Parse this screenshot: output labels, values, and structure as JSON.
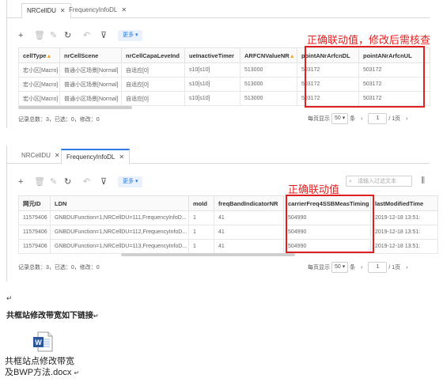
{
  "panel1": {
    "tabs": [
      {
        "label": "NRCellDU",
        "close": "✕"
      },
      {
        "label": "FrequencyInfoDL",
        "close": "✕"
      }
    ],
    "toolbar": {
      "more_label": "更多",
      "search_placeholder": ""
    },
    "columns": [
      "cellType",
      "nrCellScene",
      "nrCellCapaLeveInd",
      "ueInactiveTimer",
      "ARFCNValueNR",
      "pointANrArfcnDL",
      "pointANrArfcnUL"
    ],
    "warn_columns": [
      "cellType",
      "ARFCNValueNR"
    ],
    "rows": [
      [
        "宏小区[Macro]",
        "普通小区场景[Normal]",
        "自适应[0]",
        "s10[s10]",
        "513000",
        "503172",
        "503172"
      ],
      [
        "宏小区[Macro]",
        "普通小区场景[Normal]",
        "自适应[0]",
        "s10[s10]",
        "513000",
        "503172",
        "503172"
      ],
      [
        "宏小区[Macro]",
        "普通小区场景[Normal]",
        "自适应[0]",
        "s10[s10]",
        "513000",
        "503172",
        "503172"
      ]
    ],
    "record_info": "记录总数：3，已选：0，修改：0",
    "page_size_label": "每页显示",
    "page_size": "50",
    "page_unit": "条",
    "page_current": "1",
    "page_total": "/ 1页",
    "annotation": "正确联动值，修改后需核查"
  },
  "panel2": {
    "tabs": [
      {
        "label": "NRCellDU",
        "close": "✕"
      },
      {
        "label": "FrequencyInfoDL",
        "close": "✕"
      }
    ],
    "toolbar": {
      "more_label": "更多",
      "search_placeholder": "请输入过滤文本"
    },
    "columns": [
      "网元ID",
      "LDN",
      "moId",
      "freqBandIndicatorNR",
      "carrierFreq4SSBMeasTiming",
      "lastModifiedTime"
    ],
    "rows": [
      [
        "11579406",
        "GNBDUFunction=1,NRCellDU=111,FrequencyInfoD...",
        "1",
        "41",
        "504990",
        "2019-12-18 13:51:"
      ],
      [
        "11579406",
        "GNBDUFunction=1,NRCellDU=112,FrequencyInfoD...",
        "1",
        "41",
        "504990",
        "2019-12-18 13:51:"
      ],
      [
        "11579406",
        "GNBDUFunction=1,NRCellDU=113,FrequencyInfoD...",
        "1",
        "41",
        "504990",
        "2019-12-18 13:51:"
      ]
    ],
    "record_info": "记录总数：3，已选：0，修改：0",
    "page_size_label": "每页显示",
    "page_size": "50",
    "page_unit": "条",
    "page_current": "1",
    "page_total": "/ 1页",
    "annotation": "正确联动值"
  },
  "doc": {
    "heading": "共框站修改带宽如下链接",
    "para_mark": "↵",
    "attachment_name": "共框站点修改带宽及BWP方法.docx",
    "attachment_line1": "共框站点修改带宽",
    "attachment_line2": "及BWP方法.docx",
    "icon_letter": "W",
    "word_color": "#2b579a"
  }
}
